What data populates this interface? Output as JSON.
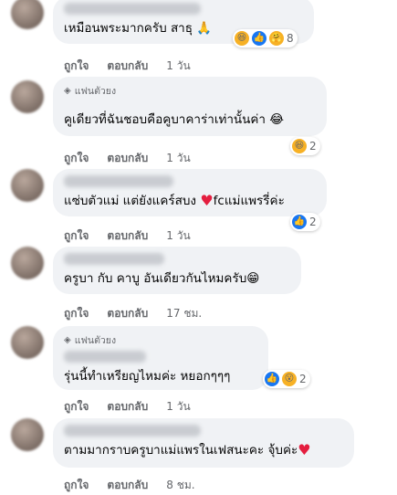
{
  "comments": [
    {
      "badge": "",
      "text": "เหมือนพระมากครับ สาธุ 🙏",
      "reaction_count": "8",
      "actions": {
        "like": "ถูกใจ",
        "reply": "ตอบกลับ",
        "time": "1 วัน"
      }
    },
    {
      "badge": "แฟนตัวยง",
      "text": "คูเดียวที่ฉันชอบคือคูบาคาร่าเท่านั้นค่า 😂",
      "reaction_count": "2",
      "actions": {
        "like": "ถูกใจ",
        "reply": "ตอบกลับ",
        "time": "1 วัน"
      }
    },
    {
      "badge": "",
      "text": "แซ่บตัวแม่ แต่ยังแคร์สบง",
      "text_suffix": "fcแม่แพรรี่ค่ะ",
      "reaction_count": "2",
      "actions": {
        "like": "ถูกใจ",
        "reply": "ตอบกลับ",
        "time": "1 วัน"
      }
    },
    {
      "badge": "",
      "text": "ครูบา กับ คาบู อันเดียวกันไหมครับ😁",
      "reaction_count": "",
      "actions": {
        "like": "ถูกใจ",
        "reply": "ตอบกลับ",
        "time": "17 ชม."
      }
    },
    {
      "badge": "แฟนตัวยง",
      "text": "รุ่นนี้ทำเหรียญไหมค่ะ หยอกๆๆๆ",
      "reaction_count": "2",
      "actions": {
        "like": "ถูกใจ",
        "reply": "ตอบกลับ",
        "time": "1 วัน"
      }
    },
    {
      "badge": "",
      "text": "ตามมากราบครูบาแม่แพรในเฟสนะคะ จุ้บค่ะ",
      "reaction_count": "",
      "actions": {
        "like": "ถูกใจ",
        "reply": "ตอบกลับ",
        "time": "8 ชม."
      }
    }
  ],
  "icons": {
    "badge": "diamond-icon",
    "reactions": [
      "haha-reaction-icon",
      "like-reaction-icon",
      "love-reaction-icon",
      "wow-reaction-icon",
      "care-reaction-icon"
    ]
  },
  "colors": {
    "bubble": "#f0f2f5",
    "meta_text": "#65676b",
    "like_blue": "#1877f2",
    "love_red": "#f33e58"
  }
}
